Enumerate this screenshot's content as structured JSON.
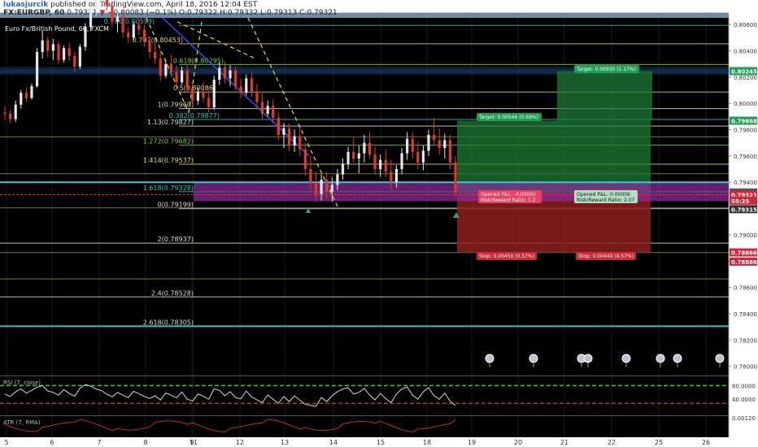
{
  "header": {
    "author": "lukasjurcik",
    "published": "published on TradingView.com, April 18, 2016 12:04 EST",
    "symbol": "FX:EURGBP, 60",
    "last": "0.79321",
    "change": "−0.00083 (−0.1%)",
    "open": "O:0.79322",
    "high": "H:0.79332",
    "low": "L:0.79313",
    "close": "C:0.79321"
  },
  "colors": {
    "background": "#000000",
    "up_candle": "#e6e6e6",
    "down_candle": "#e0392e",
    "fib": "#2fc4c4",
    "yellow_line": "#e0d85a",
    "target_zone": "#1f7a36",
    "stop_zone": "#8b1e1e",
    "purple_zone": "#8e2e9a",
    "rsi_dash": "#2ecc40"
  },
  "chart_data": {
    "type": "candlestick",
    "title": "Euro Fx/British Pound, 60, FXCM",
    "y_ticks": [
      "0.80600",
      "0.80400",
      "0.80200",
      "0.80000",
      "0.79800",
      "0.79600",
      "0.79400",
      "0.79200",
      "0.79000",
      "0.78800",
      "0.78600",
      "0.78400",
      "0.78200",
      "0.78000"
    ],
    "x_ticks": [
      "5",
      "6",
      "7",
      "8",
      "9",
      "11",
      "12",
      "13",
      "14",
      "15",
      "18",
      "19",
      "20",
      "21",
      "22",
      "25",
      "26"
    ],
    "ylim": [
      0.7793,
      0.8065
    ],
    "price_badges": [
      {
        "label": "0.80245",
        "value": 0.80245,
        "color": "#1f9d55"
      },
      {
        "label": "0.79868",
        "value": 0.79868,
        "color": "#1f9d55"
      },
      {
        "label": "0.79322",
        "value": 0.79322,
        "color": "#555555"
      },
      {
        "label": "0.79321",
        "value": 0.79305,
        "color": "#d0273a"
      },
      {
        "label": "55:25",
        "value": 0.7926,
        "color": "#d0273a"
      },
      {
        "label": "0.79315",
        "value": 0.79195,
        "color": "#333333"
      },
      {
        "label": "0.78866",
        "value": 0.78866,
        "color": "#d0273a"
      },
      {
        "label": "0.78886",
        "value": 0.78796,
        "color": "#d0273a"
      }
    ],
    "fib_levels": [
      {
        "label": "0.786(0.80593)",
        "value": 0.80593,
        "color": "#2fc4c4"
      },
      {
        "label": "0.707(0.80453)",
        "value": 0.80453,
        "color": "#e0d85a"
      },
      {
        "label": "0.618(0.80295)",
        "value": 0.80295,
        "color": "#7fd04a"
      },
      {
        "label": "0.5(0.80086)",
        "value": 0.80086,
        "color": "#e0d85a"
      },
      {
        "label": "1(0.79960)",
        "value": 0.7996,
        "color": "#dddddd"
      },
      {
        "label": "0.382(0.79877)",
        "value": 0.79877,
        "color": "#2fc4c4"
      },
      {
        "label": "1.13(0.79827)",
        "value": 0.79827,
        "color": "#dddddd"
      },
      {
        "label": "1.272(0.79682)",
        "value": 0.79682,
        "color": "#7fd04a"
      },
      {
        "label": "1.414(0.79537)",
        "value": 0.79537,
        "color": "#e0d85a"
      },
      {
        "label": "1.618(0.79328)",
        "value": 0.79328,
        "color": "#2fc4c4"
      },
      {
        "label": "0(0.79199)",
        "value": 0.79199,
        "color": "#dddddd"
      },
      {
        "label": "2(0.78937)",
        "value": 0.78937,
        "color": "#dddddd"
      },
      {
        "label": "2.4(0.78528)",
        "value": 0.78528,
        "color": "#dddddd"
      },
      {
        "label": "2.618(0.78305)",
        "value": 0.78305,
        "color": "#dddddd"
      }
    ],
    "trades": [
      {
        "target_label": "Target: 0.00546 (0.69%)",
        "stop_label": "Stop: 0.00456 (0.57%)",
        "pl_label": "Opened P&L: -0.00001",
        "rr_label": "Risk/Reward Ratio: 1.2",
        "entry": 0.79322,
        "target": 0.79868,
        "stop": 0.78866
      },
      {
        "target_label": "Target: 0.00930 (1.17%)",
        "stop_label": "Stop: 0.00449 (0.57%)",
        "pl_label": "Opened P&L: 0.00006",
        "rr_label": "Risk/Reward Ratio: 2.07",
        "entry": 0.79315,
        "target": 0.80245,
        "stop": 0.78866
      }
    ],
    "candles": [
      [
        0.7993,
        0.7998,
        0.7987,
        0.7992
      ],
      [
        0.7992,
        0.7995,
        0.7985,
        0.7988
      ],
      [
        0.7988,
        0.8002,
        0.7986,
        0.7999
      ],
      [
        0.7999,
        0.801,
        0.7996,
        0.8008
      ],
      [
        0.8008,
        0.8012,
        0.8001,
        0.8004
      ],
      [
        0.8004,
        0.8015,
        0.8003,
        0.8013
      ],
      [
        0.8013,
        0.8042,
        0.8012,
        0.8039
      ],
      [
        0.8039,
        0.8055,
        0.8034,
        0.8048
      ],
      [
        0.8048,
        0.8051,
        0.8035,
        0.804
      ],
      [
        0.804,
        0.8049,
        0.8033,
        0.8045
      ],
      [
        0.8045,
        0.8047,
        0.803,
        0.8033
      ],
      [
        0.8033,
        0.8044,
        0.8031,
        0.8042
      ],
      [
        0.8042,
        0.8046,
        0.8032,
        0.8036
      ],
      [
        0.8036,
        0.8039,
        0.8024,
        0.8028
      ],
      [
        0.8028,
        0.8045,
        0.8026,
        0.8043
      ],
      [
        0.8043,
        0.8061,
        0.804,
        0.8058
      ],
      [
        0.8058,
        0.8075,
        0.8055,
        0.8072
      ],
      [
        0.8072,
        0.8082,
        0.8066,
        0.8079
      ],
      [
        0.8079,
        0.809,
        0.8075,
        0.8086
      ],
      [
        0.8086,
        0.8092,
        0.807,
        0.8074
      ],
      [
        0.8074,
        0.8078,
        0.8058,
        0.8062
      ],
      [
        0.8062,
        0.8069,
        0.8054,
        0.8066
      ],
      [
        0.8066,
        0.8071,
        0.805,
        0.8054
      ],
      [
        0.8054,
        0.8058,
        0.8046,
        0.805
      ],
      [
        0.805,
        0.8062,
        0.8048,
        0.806
      ],
      [
        0.806,
        0.8066,
        0.8052,
        0.8056
      ],
      [
        0.8056,
        0.806,
        0.8043,
        0.8047
      ],
      [
        0.8047,
        0.8051,
        0.8034,
        0.8039
      ],
      [
        0.8039,
        0.8046,
        0.803,
        0.8034
      ],
      [
        0.8034,
        0.804,
        0.8017,
        0.8021
      ],
      [
        0.8021,
        0.8033,
        0.8019,
        0.803
      ],
      [
        0.803,
        0.8037,
        0.802,
        0.8024
      ],
      [
        0.8024,
        0.8029,
        0.8012,
        0.8016
      ],
      [
        0.8016,
        0.8028,
        0.8014,
        0.8025
      ],
      [
        0.8025,
        0.803,
        0.8008,
        0.8011
      ],
      [
        0.8011,
        0.8015,
        0.7998,
        0.8002
      ],
      [
        0.8002,
        0.8012,
        0.7999,
        0.8009
      ],
      [
        0.8009,
        0.8016,
        0.8001,
        0.8004
      ],
      [
        0.8004,
        0.801,
        0.7993,
        0.7997
      ],
      [
        0.7997,
        0.8021,
        0.7995,
        0.8018
      ],
      [
        0.8018,
        0.8031,
        0.8014,
        0.8027
      ],
      [
        0.8027,
        0.8032,
        0.8015,
        0.8019
      ],
      [
        0.8019,
        0.8029,
        0.8013,
        0.8025
      ],
      [
        0.8025,
        0.8028,
        0.801,
        0.8013
      ],
      [
        0.8013,
        0.8019,
        0.8004,
        0.8008
      ],
      [
        0.8008,
        0.8022,
        0.8006,
        0.8019
      ],
      [
        0.8019,
        0.8024,
        0.8005,
        0.8009
      ],
      [
        0.8009,
        0.8015,
        0.7996,
        0.8001
      ],
      [
        0.8001,
        0.8008,
        0.7988,
        0.7992
      ],
      [
        0.7992,
        0.8002,
        0.799,
        0.7998
      ],
      [
        0.7998,
        0.8003,
        0.7985,
        0.7989
      ],
      [
        0.7989,
        0.7993,
        0.7972,
        0.7976
      ],
      [
        0.7976,
        0.7985,
        0.7966,
        0.7981
      ],
      [
        0.7981,
        0.7985,
        0.7964,
        0.7968
      ],
      [
        0.7968,
        0.798,
        0.7963,
        0.7975
      ],
      [
        0.7975,
        0.7982,
        0.796,
        0.7965
      ],
      [
        0.7965,
        0.797,
        0.7945,
        0.795
      ],
      [
        0.795,
        0.796,
        0.7934,
        0.7939
      ],
      [
        0.7939,
        0.7948,
        0.7925,
        0.7931
      ],
      [
        0.7931,
        0.7946,
        0.7926,
        0.7942
      ],
      [
        0.7942,
        0.7948,
        0.7928,
        0.7933
      ],
      [
        0.7933,
        0.7944,
        0.7925,
        0.7938
      ],
      [
        0.7938,
        0.795,
        0.7934,
        0.7946
      ],
      [
        0.7946,
        0.7958,
        0.7942,
        0.7954
      ],
      [
        0.7954,
        0.7967,
        0.795,
        0.7963
      ],
      [
        0.7963,
        0.7974,
        0.7955,
        0.7958
      ],
      [
        0.7958,
        0.7968,
        0.7947,
        0.7962
      ],
      [
        0.7962,
        0.7976,
        0.7955,
        0.797
      ],
      [
        0.797,
        0.7978,
        0.7958,
        0.7961
      ],
      [
        0.7961,
        0.7967,
        0.7946,
        0.795
      ],
      [
        0.795,
        0.7961,
        0.7944,
        0.7957
      ],
      [
        0.7957,
        0.7965,
        0.7944,
        0.7948
      ],
      [
        0.7948,
        0.7957,
        0.7934,
        0.794
      ],
      [
        0.794,
        0.7953,
        0.7936,
        0.795
      ],
      [
        0.795,
        0.7966,
        0.7946,
        0.7962
      ],
      [
        0.7962,
        0.7978,
        0.7957,
        0.7973
      ],
      [
        0.7973,
        0.7978,
        0.7958,
        0.7963
      ],
      [
        0.7963,
        0.7971,
        0.795,
        0.7955
      ],
      [
        0.7955,
        0.7968,
        0.7949,
        0.7964
      ],
      [
        0.7964,
        0.798,
        0.796,
        0.7976
      ],
      [
        0.7976,
        0.7989,
        0.7968,
        0.7972
      ],
      [
        0.7972,
        0.7981,
        0.7961,
        0.7966
      ],
      [
        0.7966,
        0.7977,
        0.7958,
        0.7972
      ],
      [
        0.7972,
        0.7976,
        0.795,
        0.7955
      ],
      [
        0.7955,
        0.796,
        0.7929,
        0.7932
      ]
    ],
    "rsi": {
      "label": "RSI (7, close)",
      "ticks": [
        "80.0000",
        "40.0000"
      ],
      "ylim": [
        0,
        100
      ],
      "values": [
        55,
        48,
        62,
        70,
        58,
        66,
        75,
        80,
        64,
        60,
        52,
        68,
        57,
        49,
        72,
        83,
        78,
        70,
        65,
        55,
        47,
        60,
        52,
        45,
        63,
        56,
        48,
        42,
        50,
        38,
        58,
        52,
        44,
        61,
        40,
        35,
        55,
        49,
        40,
        70,
        66,
        50,
        62,
        45,
        41,
        64,
        47,
        38,
        30,
        52,
        40,
        28,
        48,
        33,
        50,
        37,
        25,
        22,
        20,
        45,
        33,
        50,
        62,
        70,
        74,
        55,
        60,
        72,
        52,
        38,
        57,
        42,
        30,
        55,
        70,
        76,
        52,
        40,
        62,
        74,
        50,
        40,
        58,
        34,
        22
      ]
    },
    "atr": {
      "label": "ATR (7, RMA)",
      "ticks": [
        "0.00120"
      ]
    }
  }
}
